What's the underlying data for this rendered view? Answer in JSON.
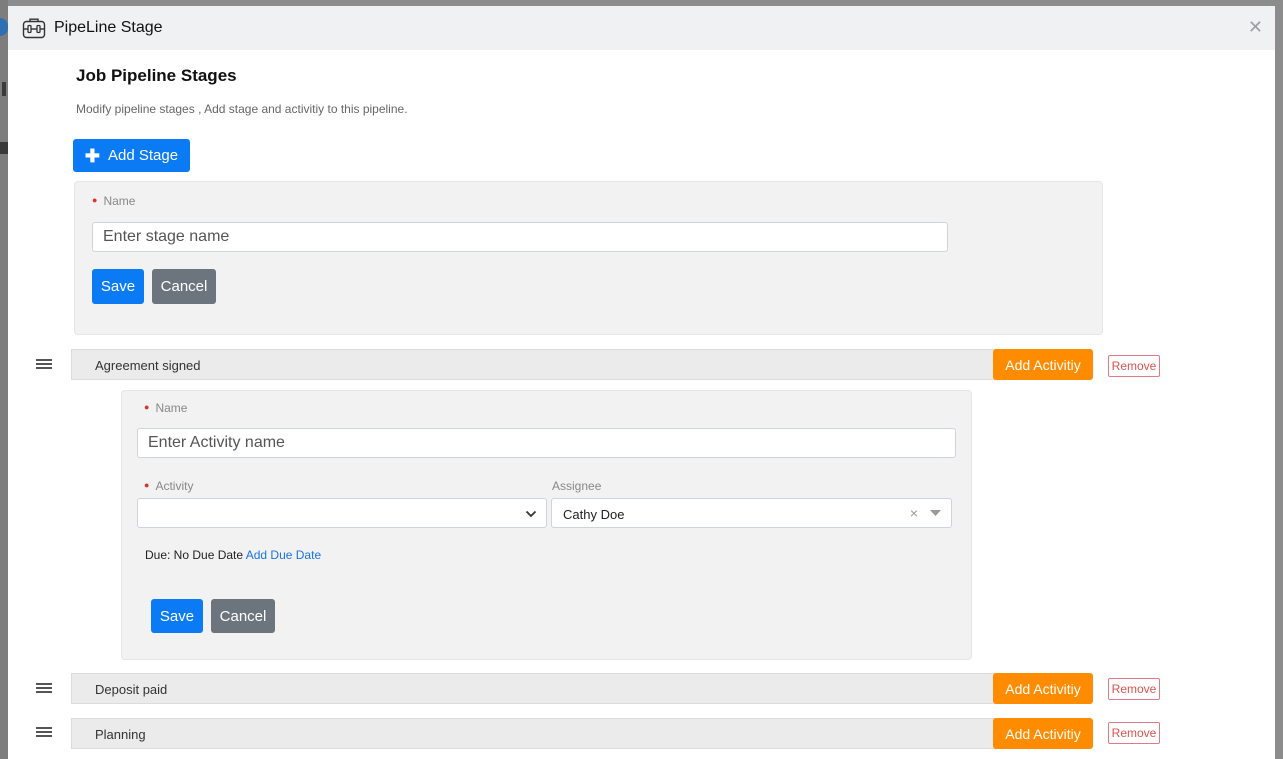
{
  "modal": {
    "title": "PipeLine Stage",
    "close_icon": "close-icon",
    "header_icon": "pipeline-icon"
  },
  "page": {
    "title": "Job Pipeline Stages",
    "subtitle": "Modify pipeline stages , Add stage and activitiy to this pipeline."
  },
  "add_stage_button": {
    "label": "Add Stage",
    "icon": "plus-icon"
  },
  "stage_form": {
    "name_label": "Name",
    "name_placeholder": "Enter stage name",
    "name_value": "",
    "save_label": "Save",
    "cancel_label": "Cancel"
  },
  "stages": [
    {
      "name": "Agreement signed",
      "add_activity_label": "Add Activitiy",
      "remove_label": "Remove"
    },
    {
      "name": "Deposit paid",
      "add_activity_label": "Add Activitiy",
      "remove_label": "Remove"
    },
    {
      "name": "Planning",
      "add_activity_label": "Add Activitiy",
      "remove_label": "Remove"
    }
  ],
  "activity_form": {
    "name_label": "Name",
    "name_placeholder": "Enter Activity name",
    "activity_label": "Activity",
    "activity_value": "",
    "assignee_label": "Assignee",
    "assignee_value": "Cathy Doe",
    "due_label": "Due: No Due Date",
    "add_due_link": "Add Due Date",
    "save_label": "Save",
    "cancel_label": "Cancel"
  },
  "colors": {
    "primary": "#0b7bf5",
    "secondary": "#6c757d",
    "orange": "#ff8c00",
    "danger": "#d9534f",
    "required_dot": "#d9342b"
  }
}
